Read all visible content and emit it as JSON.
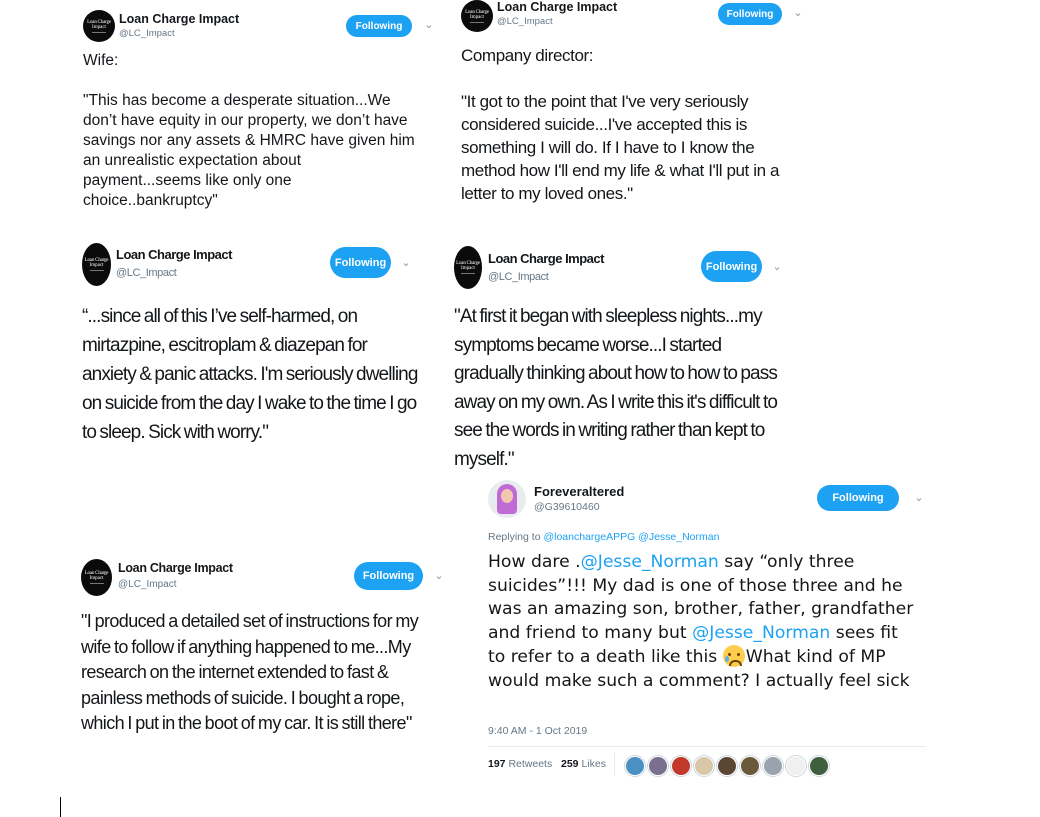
{
  "account": {
    "name": "Loan Charge Impact",
    "handle": "@LC_Impact",
    "avatar_text_line1": "Loan Charge",
    "avatar_text_line2": "Impact"
  },
  "follow_label": "Following",
  "tweets": [
    {
      "text": "Wife:\n\n\"This has become a desperate situation...We don’t have equity in our property, we don’t have savings nor any assets & HMRC have given him an unrealistic expectation about payment...seems like only one choice..bankruptcy\""
    },
    {
      "text": "Company director:\n\n\"It got to the point that I've very seriously considered suicide...I've accepted this is something I will do. If I have to I know the method how I'll end my life & what I'll put in a letter to my loved ones.\""
    },
    {
      "text": "“...since all of this I’ve self-harmed, on mirtazpine, escitroplam & diazepan for anxiety & panic attacks. I'm seriously dwelling on suicide from the day I wake to the time I go to sleep. Sick with worry.\""
    },
    {
      "text": "\"At first it began with sleepless nights...my symptoms became worse...I started gradually thinking about how to how to pass away on my own. As I write this it's difficult to see the words in writing rather than kept to myself.\""
    },
    {
      "text": "\"I produced a detailed set of instructions for my wife to follow if anything happened to me...My research on the internet extended to fast & painless methods of suicide. I bought a rope, which I put in the boot of my car. It is still there\""
    }
  ],
  "reply_tweet": {
    "name": "Foreveraltered",
    "handle": "@G39610460",
    "replying_label": "Replying to",
    "replying_to_1": "@loanchargeAPPG",
    "replying_to_2": "@Jesse_Norman",
    "text_1": "How dare .",
    "mention_1": "@Jesse_Norman",
    "text_2": " say “only three suicides”!!! My dad is one of those three and he was an amazing son, brother, father, grandfather and friend to many but ",
    "mention_2": "@Jesse_Norman",
    "text_3": " sees fit to refer to a death like this ",
    "emoji": "crying-face",
    "text_4": "What kind of MP would make such a comment? I actually feel sick",
    "timestamp": "9:40 AM - 1 Oct 2019",
    "retweets_count": "197",
    "retweets_label": "Retweets",
    "likes_count": "259",
    "likes_label": "Likes",
    "liker_colors": [
      "#4a90c2",
      "#7a6f8f",
      "#c0392b",
      "#d9c7a7",
      "#5a4632",
      "#6b5a3a",
      "#9aa3ad",
      "#f0f0f0",
      "#3f5f3f"
    ]
  },
  "colors": {
    "accent": "#1da1f2",
    "text": "#14171a",
    "muted": "#657786"
  }
}
